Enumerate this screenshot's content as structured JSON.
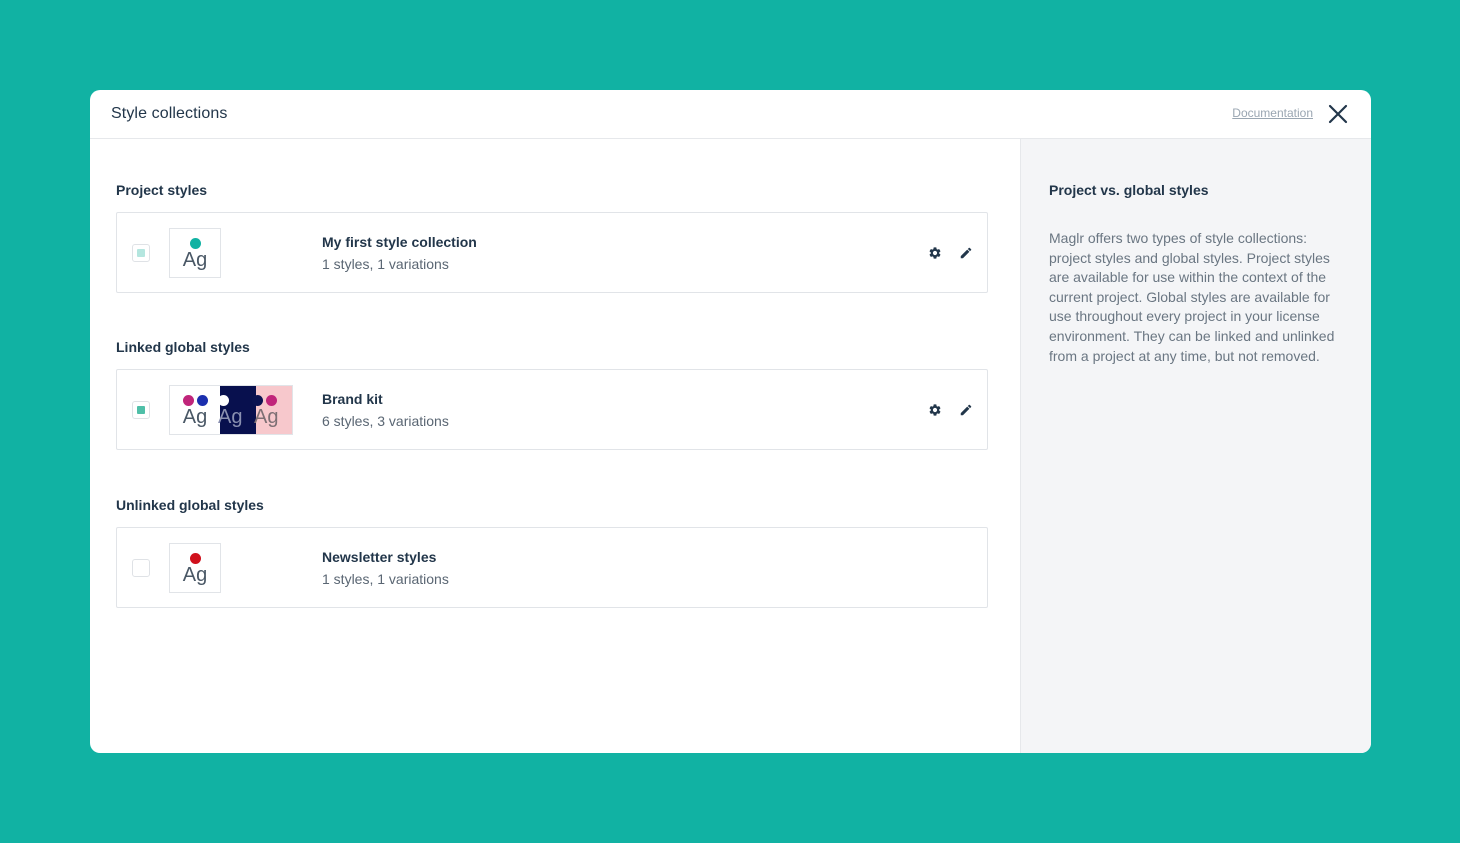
{
  "modal": {
    "title": "Style collections",
    "doc_link": "Documentation"
  },
  "sections": {
    "project": {
      "title": "Project styles"
    },
    "linked": {
      "title": "Linked global styles"
    },
    "unlinked": {
      "title": "Unlinked global styles"
    }
  },
  "collections": {
    "project": {
      "name": "My first style collection",
      "summary": "1 styles, 1 variations",
      "checked": "partial",
      "check_color": "#b4e6df",
      "thumb_text": "Ag",
      "dot_colors": [
        "#11b2a3"
      ]
    },
    "brand": {
      "name": "Brand kit",
      "summary": "6 styles, 3 variations",
      "checked": "true",
      "check_color": "#4fbfa8",
      "thumb_text": "Ag",
      "variant_bgs": [
        "#ffffff",
        "#08104e",
        "#f7c8cc"
      ]
    },
    "newsletter": {
      "name": "Newsletter styles",
      "summary": "1 styles, 1 variations",
      "checked": "false",
      "thumb_text": "Ag",
      "dot_colors": [
        "#d0101c"
      ]
    }
  },
  "aside": {
    "title": "Project vs. global styles",
    "text": "Maglr offers two types of style collections: project styles and global styles. Project styles are available for use within the context of the current project. Global styles are available for use throughout every project in your license environment. They can be linked and unlinked from a project at any time, but not removed."
  },
  "icons": {
    "settings": "gear-icon",
    "edit": "pencil-icon",
    "close": "close-icon"
  },
  "colors": {
    "background": "#11b2a3",
    "text_dark": "#22364a",
    "text_muted": "#6a7682"
  }
}
